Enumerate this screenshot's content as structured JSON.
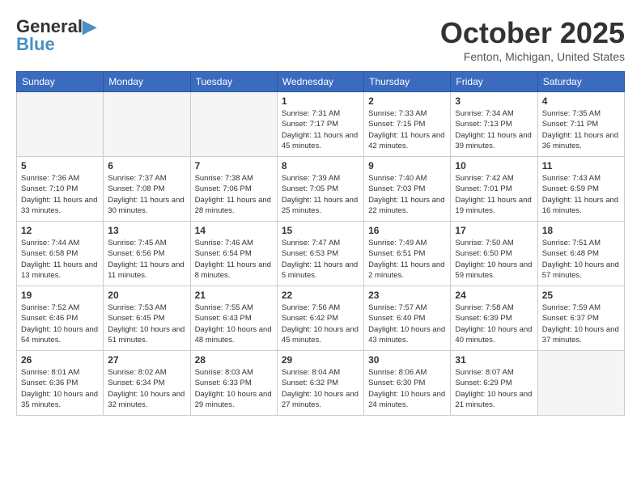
{
  "header": {
    "logo_line1": "General",
    "logo_line2": "Blue",
    "month": "October 2025",
    "location": "Fenton, Michigan, United States"
  },
  "weekdays": [
    "Sunday",
    "Monday",
    "Tuesday",
    "Wednesday",
    "Thursday",
    "Friday",
    "Saturday"
  ],
  "weeks": [
    [
      {
        "day": "",
        "info": "",
        "empty": true
      },
      {
        "day": "",
        "info": "",
        "empty": true
      },
      {
        "day": "",
        "info": "",
        "empty": true
      },
      {
        "day": "1",
        "info": "Sunrise: 7:31 AM\nSunset: 7:17 PM\nDaylight: 11 hours\nand 45 minutes.",
        "empty": false
      },
      {
        "day": "2",
        "info": "Sunrise: 7:33 AM\nSunset: 7:15 PM\nDaylight: 11 hours\nand 42 minutes.",
        "empty": false
      },
      {
        "day": "3",
        "info": "Sunrise: 7:34 AM\nSunset: 7:13 PM\nDaylight: 11 hours\nand 39 minutes.",
        "empty": false
      },
      {
        "day": "4",
        "info": "Sunrise: 7:35 AM\nSunset: 7:11 PM\nDaylight: 11 hours\nand 36 minutes.",
        "empty": false
      }
    ],
    [
      {
        "day": "5",
        "info": "Sunrise: 7:36 AM\nSunset: 7:10 PM\nDaylight: 11 hours\nand 33 minutes.",
        "empty": false
      },
      {
        "day": "6",
        "info": "Sunrise: 7:37 AM\nSunset: 7:08 PM\nDaylight: 11 hours\nand 30 minutes.",
        "empty": false
      },
      {
        "day": "7",
        "info": "Sunrise: 7:38 AM\nSunset: 7:06 PM\nDaylight: 11 hours\nand 28 minutes.",
        "empty": false
      },
      {
        "day": "8",
        "info": "Sunrise: 7:39 AM\nSunset: 7:05 PM\nDaylight: 11 hours\nand 25 minutes.",
        "empty": false
      },
      {
        "day": "9",
        "info": "Sunrise: 7:40 AM\nSunset: 7:03 PM\nDaylight: 11 hours\nand 22 minutes.",
        "empty": false
      },
      {
        "day": "10",
        "info": "Sunrise: 7:42 AM\nSunset: 7:01 PM\nDaylight: 11 hours\nand 19 minutes.",
        "empty": false
      },
      {
        "day": "11",
        "info": "Sunrise: 7:43 AM\nSunset: 6:59 PM\nDaylight: 11 hours\nand 16 minutes.",
        "empty": false
      }
    ],
    [
      {
        "day": "12",
        "info": "Sunrise: 7:44 AM\nSunset: 6:58 PM\nDaylight: 11 hours\nand 13 minutes.",
        "empty": false
      },
      {
        "day": "13",
        "info": "Sunrise: 7:45 AM\nSunset: 6:56 PM\nDaylight: 11 hours\nand 11 minutes.",
        "empty": false
      },
      {
        "day": "14",
        "info": "Sunrise: 7:46 AM\nSunset: 6:54 PM\nDaylight: 11 hours\nand 8 minutes.",
        "empty": false
      },
      {
        "day": "15",
        "info": "Sunrise: 7:47 AM\nSunset: 6:53 PM\nDaylight: 11 hours\nand 5 minutes.",
        "empty": false
      },
      {
        "day": "16",
        "info": "Sunrise: 7:49 AM\nSunset: 6:51 PM\nDaylight: 11 hours\nand 2 minutes.",
        "empty": false
      },
      {
        "day": "17",
        "info": "Sunrise: 7:50 AM\nSunset: 6:50 PM\nDaylight: 10 hours\nand 59 minutes.",
        "empty": false
      },
      {
        "day": "18",
        "info": "Sunrise: 7:51 AM\nSunset: 6:48 PM\nDaylight: 10 hours\nand 57 minutes.",
        "empty": false
      }
    ],
    [
      {
        "day": "19",
        "info": "Sunrise: 7:52 AM\nSunset: 6:46 PM\nDaylight: 10 hours\nand 54 minutes.",
        "empty": false
      },
      {
        "day": "20",
        "info": "Sunrise: 7:53 AM\nSunset: 6:45 PM\nDaylight: 10 hours\nand 51 minutes.",
        "empty": false
      },
      {
        "day": "21",
        "info": "Sunrise: 7:55 AM\nSunset: 6:43 PM\nDaylight: 10 hours\nand 48 minutes.",
        "empty": false
      },
      {
        "day": "22",
        "info": "Sunrise: 7:56 AM\nSunset: 6:42 PM\nDaylight: 10 hours\nand 45 minutes.",
        "empty": false
      },
      {
        "day": "23",
        "info": "Sunrise: 7:57 AM\nSunset: 6:40 PM\nDaylight: 10 hours\nand 43 minutes.",
        "empty": false
      },
      {
        "day": "24",
        "info": "Sunrise: 7:58 AM\nSunset: 6:39 PM\nDaylight: 10 hours\nand 40 minutes.",
        "empty": false
      },
      {
        "day": "25",
        "info": "Sunrise: 7:59 AM\nSunset: 6:37 PM\nDaylight: 10 hours\nand 37 minutes.",
        "empty": false
      }
    ],
    [
      {
        "day": "26",
        "info": "Sunrise: 8:01 AM\nSunset: 6:36 PM\nDaylight: 10 hours\nand 35 minutes.",
        "empty": false
      },
      {
        "day": "27",
        "info": "Sunrise: 8:02 AM\nSunset: 6:34 PM\nDaylight: 10 hours\nand 32 minutes.",
        "empty": false
      },
      {
        "day": "28",
        "info": "Sunrise: 8:03 AM\nSunset: 6:33 PM\nDaylight: 10 hours\nand 29 minutes.",
        "empty": false
      },
      {
        "day": "29",
        "info": "Sunrise: 8:04 AM\nSunset: 6:32 PM\nDaylight: 10 hours\nand 27 minutes.",
        "empty": false
      },
      {
        "day": "30",
        "info": "Sunrise: 8:06 AM\nSunset: 6:30 PM\nDaylight: 10 hours\nand 24 minutes.",
        "empty": false
      },
      {
        "day": "31",
        "info": "Sunrise: 8:07 AM\nSunset: 6:29 PM\nDaylight: 10 hours\nand 21 minutes.",
        "empty": false
      },
      {
        "day": "",
        "info": "",
        "empty": true
      }
    ]
  ]
}
